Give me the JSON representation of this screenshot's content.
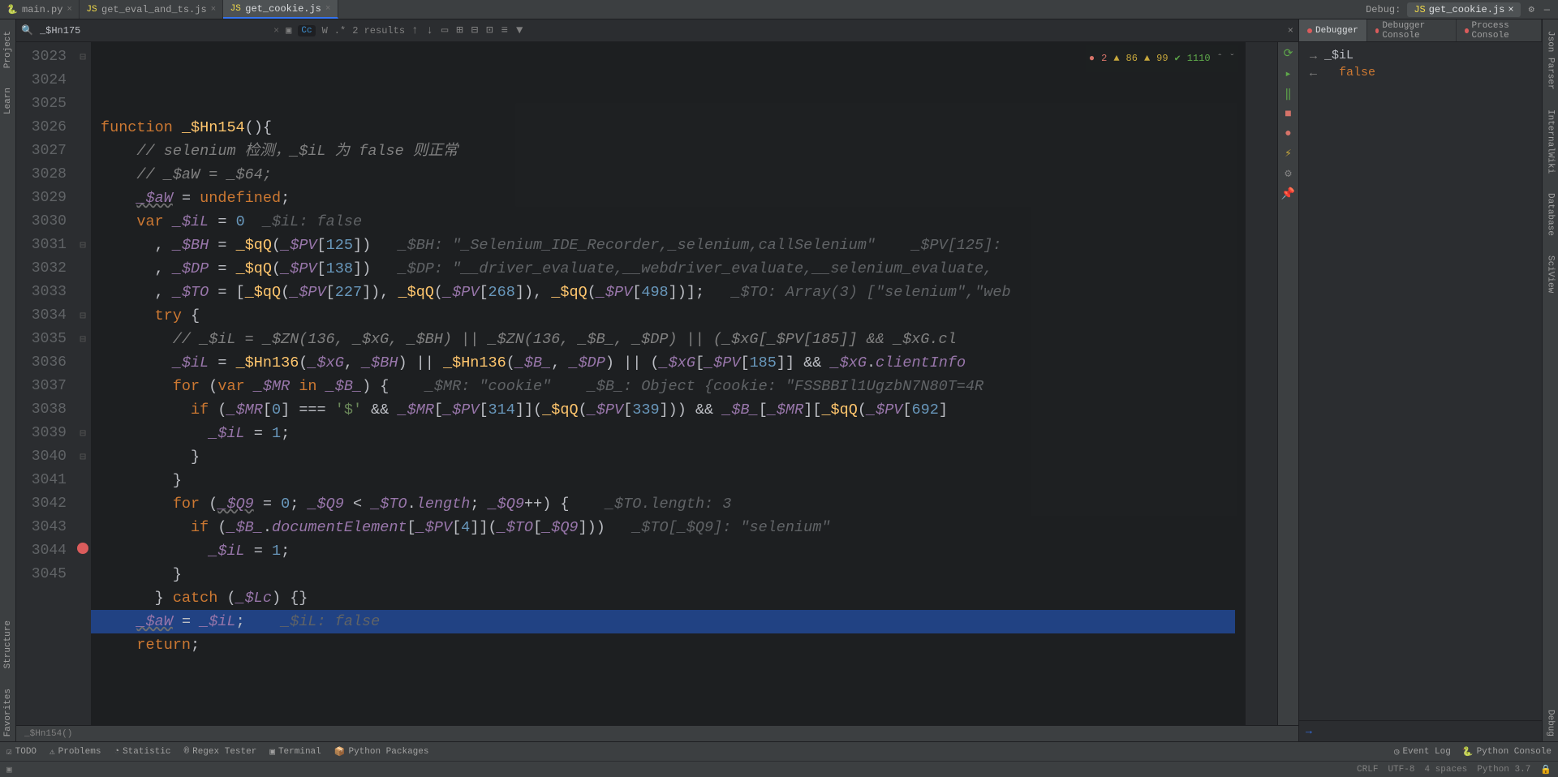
{
  "tabs": [
    {
      "label": "main.py",
      "active": false
    },
    {
      "label": "get_eval_and_ts.js",
      "active": false
    },
    {
      "label": "get_cookie.js",
      "active": true
    }
  ],
  "debug_label": "Debug:",
  "debug_tab": "get_cookie.js",
  "search": {
    "value": "_$Hn175",
    "results": "2 results"
  },
  "inspections": {
    "errors": "2",
    "warn1": "86",
    "warn2": "99",
    "ok": "1110"
  },
  "left_tools": [
    "Project",
    "Learn",
    "Structure",
    "Favorites"
  ],
  "right_tools": [
    "Json Parser",
    "InternalWiki",
    "Database",
    "SciView",
    "Debug"
  ],
  "code_lines": [
    {
      "n": 3023,
      "html": "<span class='kw'>function</span> <span class='fn'>_$Hn154</span><span class='op'>(){</span>"
    },
    {
      "n": 3024,
      "html": "    <span class='cmt'>// selenium 检测，_$iL 为 false 则正常</span>"
    },
    {
      "n": 3025,
      "html": "    <span class='cmt'>// _$aW = _$64;</span>"
    },
    {
      "n": 3026,
      "html": "    <span class='idw'>_$aW</span> <span class='op'>=</span> <span class='lit'>undefined</span><span class='op'>;</span>"
    },
    {
      "n": 3027,
      "html": "    <span class='kw'>var</span> <span class='id'>_$iL</span> <span class='op'>=</span> <span class='num'>0</span>  <span class='inlay'>_$iL: false</span>"
    },
    {
      "n": 3028,
      "html": "      <span class='op'>,</span> <span class='id'>_$BH</span> <span class='op'>=</span> <span class='fn'>_$qQ</span><span class='op'>(</span><span class='id'>_$PV</span><span class='op'>[</span><span class='num'>125</span><span class='op'>])</span>   <span class='inlay'>_$BH: \"_Selenium_IDE_Recorder,_selenium,callSelenium\"    _$PV[125]:</span>"
    },
    {
      "n": 3029,
      "html": "      <span class='op'>,</span> <span class='id'>_$DP</span> <span class='op'>=</span> <span class='fn'>_$qQ</span><span class='op'>(</span><span class='id'>_$PV</span><span class='op'>[</span><span class='num'>138</span><span class='op'>])</span>   <span class='inlay'>_$DP: \"__driver_evaluate,__webdriver_evaluate,__selenium_evaluate,</span>"
    },
    {
      "n": 3030,
      "html": "      <span class='op'>,</span> <span class='id'>_$TO</span> <span class='op'>= [</span><span class='fn'>_$qQ</span><span class='op'>(</span><span class='id'>_$PV</span><span class='op'>[</span><span class='num'>227</span><span class='op'>]),</span> <span class='fn'>_$qQ</span><span class='op'>(</span><span class='id'>_$PV</span><span class='op'>[</span><span class='num'>268</span><span class='op'>]),</span> <span class='fn'>_$qQ</span><span class='op'>(</span><span class='id'>_$PV</span><span class='op'>[</span><span class='num'>498</span><span class='op'>])];</span>   <span class='inlay'>_$TO: Array(3) [\"selenium\",\"web</span>"
    },
    {
      "n": 3031,
      "html": "      <span class='kw'>try</span> <span class='op'>{</span>"
    },
    {
      "n": 3032,
      "html": "        <span class='cmt'>// _$iL = _$ZN(136, _$xG, _$BH) || _$ZN(136, _$B_, _$DP) || (_$xG[_$PV[185]] && _$xG.cl</span>"
    },
    {
      "n": 3033,
      "html": "        <span class='id'>_$iL</span> <span class='op'>=</span> <span class='fn'>_$Hn136</span><span class='op'>(</span><span class='id'>_$xG</span><span class='op'>,</span> <span class='id'>_$BH</span><span class='op'>) ||</span> <span class='fn'>_$Hn136</span><span class='op'>(</span><span class='id'>_$B_</span><span class='op'>,</span> <span class='id'>_$DP</span><span class='op'>) || (</span><span class='id'>_$xG</span><span class='op'>[</span><span class='id'>_$PV</span><span class='op'>[</span><span class='num'>185</span><span class='op'>]] &&</span> <span class='id'>_$xG</span><span class='op'>.</span><span class='id'>clientInfo</span>"
    },
    {
      "n": 3034,
      "html": "        <span class='kw'>for</span> <span class='op'>(</span><span class='kw'>var</span> <span class='id'>_$MR</span> <span class='kw'>in</span> <span class='id'>_$B_</span><span class='op'>) {</span>    <span class='inlay'>_$MR: \"cookie\"    _$B_: Object {cookie: \"FSSBBIl1UgzbN7N80T=4R</span>"
    },
    {
      "n": 3035,
      "html": "          <span class='kw'>if</span> <span class='op'>(</span><span class='id'>_$MR</span><span class='op'>[</span><span class='num'>0</span><span class='op'>] ===</span> <span class='str'>'$'</span> <span class='op'>&&</span> <span class='id'>_$MR</span><span class='op'>[</span><span class='id'>_$PV</span><span class='op'>[</span><span class='num'>314</span><span class='op'>]](</span><span class='fn'>_$qQ</span><span class='op'>(</span><span class='id'>_$PV</span><span class='op'>[</span><span class='num'>339</span><span class='op'>])) &&</span> <span class='id'>_$B_</span><span class='op'>[</span><span class='id'>_$MR</span><span class='op'>][</span><span class='fn'>_$qQ</span><span class='op'>(</span><span class='id'>_$PV</span><span class='op'>[</span><span class='num'>692</span><span class='op'>]</span>"
    },
    {
      "n": 3036,
      "html": "            <span class='id'>_$iL</span> <span class='op'>=</span> <span class='num'>1</span><span class='op'>;</span>"
    },
    {
      "n": 3037,
      "html": "          <span class='op'>}</span>"
    },
    {
      "n": 3038,
      "html": "        <span class='op'>}</span>"
    },
    {
      "n": 3039,
      "html": "        <span class='kw'>for</span> <span class='op'>(</span><span class='idw'>_$Q9</span> <span class='op'>=</span> <span class='num'>0</span><span class='op'>;</span> <span class='id'>_$Q9</span> <span class='op'>&lt;</span> <span class='id'>_$TO</span><span class='op'>.</span><span class='id'>length</span><span class='op'>;</span> <span class='id'>_$Q9</span><span class='op'>++) {</span>    <span class='inlay'>_$TO.length: 3</span>"
    },
    {
      "n": 3040,
      "html": "          <span class='kw'>if</span> <span class='op'>(</span><span class='id'>_$B_</span><span class='op'>.</span><span class='id'>documentElement</span><span class='op'>[</span><span class='id'>_$PV</span><span class='op'>[</span><span class='num'>4</span><span class='op'>]](</span><span class='id'>_$TO</span><span class='op'>[</span><span class='id'>_$Q9</span><span class='op'>]))</span>   <span class='inlay'>_$TO[_$Q9]: \"selenium\"</span>"
    },
    {
      "n": 3041,
      "html": "            <span class='id'>_$iL</span> <span class='op'>=</span> <span class='num'>1</span><span class='op'>;</span>"
    },
    {
      "n": 3042,
      "html": "        <span class='op'>}</span>"
    },
    {
      "n": 3043,
      "html": "      <span class='op'>}</span> <span class='kw'>catch</span> <span class='op'>(</span><span class='id'>_$Lc</span><span class='op'>) {}</span>"
    },
    {
      "n": 3044,
      "html": "    <span class='idw'>_$aW</span> <span class='op'>=</span> <span class='id'>_$iL</span><span class='op'>;</span>    <span class='inlay'>_$iL: false</span>",
      "hl": true,
      "bp": true
    },
    {
      "n": 3045,
      "html": "    <span class='kw'>return</span><span class='op'>;</span>"
    }
  ],
  "breadcrumb": "_$Hn154()",
  "debugger": {
    "tabs": [
      "Debugger",
      "Debugger Console",
      "Process Console"
    ],
    "expr": "_$iL",
    "result": "false"
  },
  "left_tool_strip": [
    "⟳",
    "▸",
    "‖",
    "■",
    "●",
    "⚡",
    "⚙",
    "📌"
  ],
  "status_items": [
    "TODO",
    "Problems",
    "Statistic",
    "Regex Tester",
    "Terminal",
    "Python Packages"
  ],
  "status_right": [
    "Event Log",
    "Python Console"
  ],
  "bottom_status": [
    "CRLF",
    "UTF-8",
    "4 spaces",
    "Python 3.7"
  ]
}
